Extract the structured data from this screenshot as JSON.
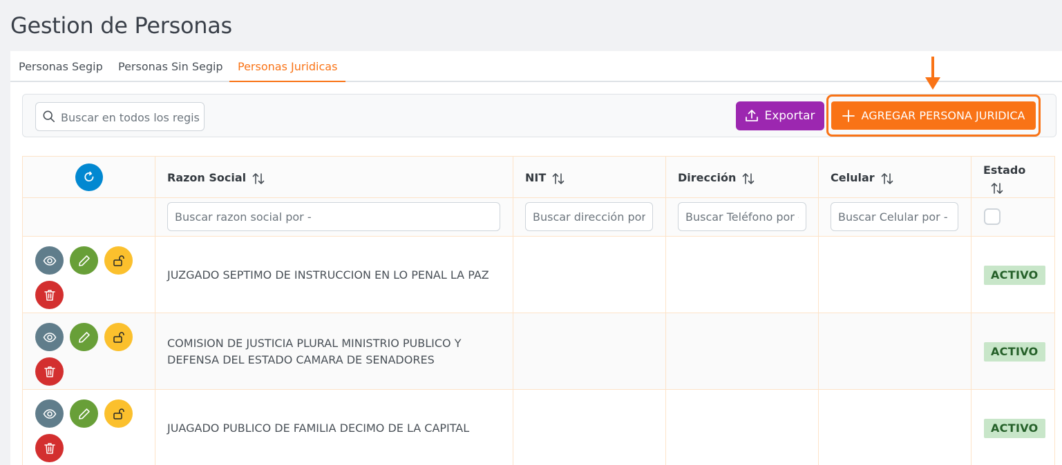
{
  "page": {
    "title": "Gestion de Personas"
  },
  "tabs": [
    {
      "label": "Personas Segip",
      "active": false
    },
    {
      "label": "Personas Sin Segip",
      "active": false
    },
    {
      "label": "Personas Juridicas",
      "active": true
    }
  ],
  "toolbar": {
    "search_placeholder": "Buscar en todos los regist",
    "export_label": "Exportar",
    "add_label": "AGREGAR PERSONA JURIDICA"
  },
  "table": {
    "columns": [
      {
        "key": "acciones",
        "label": ""
      },
      {
        "key": "razon_social",
        "label": "Razon Social"
      },
      {
        "key": "nit",
        "label": "NIT"
      },
      {
        "key": "direccion",
        "label": "Dirección"
      },
      {
        "key": "celular",
        "label": "Celular"
      },
      {
        "key": "estado",
        "label": "Estado"
      }
    ],
    "filters": {
      "razon_social": "Buscar razon social por -",
      "nit": "Buscar dirección por -",
      "direccion": "Buscar Teléfono por -",
      "celular": "Buscar Celular por -"
    },
    "rows": [
      {
        "razon_social": "JUZGADO SEPTIMO DE INSTRUCCION EN LO PENAL LA PAZ",
        "nit": "",
        "direccion": "",
        "celular": "",
        "estado": "ACTIVO"
      },
      {
        "razon_social": "COMISION DE JUSTICIA PLURAL MINISTRIO PUBLICO Y DEFENSA DEL ESTADO CAMARA DE SENADORES",
        "nit": "",
        "direccion": "",
        "celular": "",
        "estado": "ACTIVO"
      },
      {
        "razon_social": "JUAGADO PUBLICO DE FAMILIA DECIMO DE LA CAPITAL",
        "nit": "",
        "direccion": "",
        "celular": "",
        "estado": "ACTIVO"
      }
    ]
  },
  "colors": {
    "accent": "#f97316",
    "export": "#9c27b0",
    "refresh": "#0288d1",
    "view": "#607d8b",
    "edit": "#689f38",
    "lock": "#fbc02d",
    "delete": "#d32f2f",
    "active_badge_bg": "#c8e6c9",
    "active_badge_text": "#256029"
  },
  "icons": {
    "search": "search-icon",
    "export": "upload-icon",
    "add": "plus-icon",
    "refresh": "refresh-icon",
    "sort": "sort-icon",
    "view": "eye-icon",
    "edit": "pencil-icon",
    "lock": "unlock-icon",
    "delete": "trash-icon",
    "callout": "arrow-down-icon"
  }
}
